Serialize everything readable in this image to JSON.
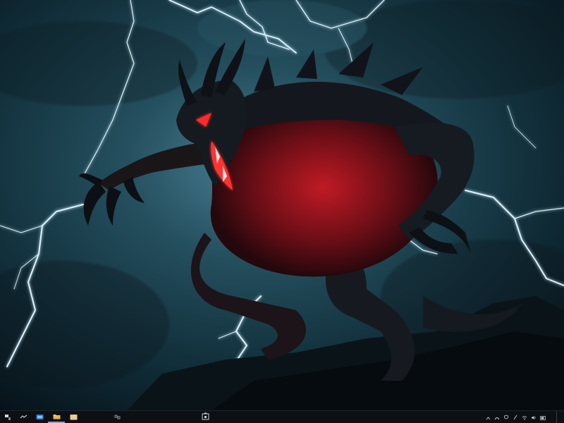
{
  "wallpaper": {
    "description_icon": "demon-creature-lightning",
    "colors": {
      "sky": "#1f4556",
      "lightning": "#d9f3ff",
      "creature_dark": "#12161c",
      "creature_red": "#8a1420",
      "glow": "#ff2a2a"
    }
  },
  "taskbar": {
    "start_icon": "start-icon",
    "search_icon": "search-icon",
    "task_view_icon": "task-view-icon",
    "pinned_apps": [
      {
        "icon": "edge-icon",
        "active": false
      },
      {
        "icon": "file-explorer-icon",
        "active": true
      },
      {
        "icon": "folder-icon",
        "active": false
      }
    ],
    "clock": {
      "time": "",
      "date": ""
    },
    "colors": {
      "background": "#0c1014",
      "accent": "#7aa8d8"
    }
  }
}
